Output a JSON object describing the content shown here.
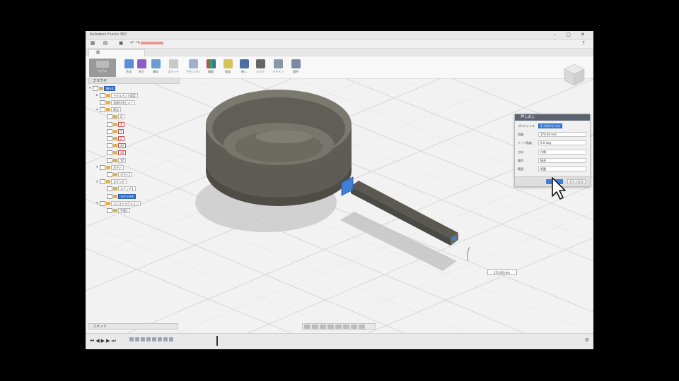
{
  "window": {
    "title": "Autodesk Fusion 360",
    "controls": "– ▢ ✕"
  },
  "document_tab": {
    "label": "鍋"
  },
  "toolbar": {
    "workspace_label": "モデル",
    "tools": [
      {
        "label": "作成",
        "icon": "create-icon"
      },
      {
        "label": "修正",
        "icon": "modify-icon"
      },
      {
        "label": "構成",
        "icon": "construct-icon"
      },
      {
        "label": "スケッチ",
        "icon": "sketch-icon"
      },
      {
        "label": "アセンブリ",
        "icon": "assemble-icon"
      },
      {
        "label": "構築",
        "icon": "build-icon"
      },
      {
        "label": "検査",
        "icon": "inspect-icon"
      },
      {
        "label": "挿入",
        "icon": "insert-icon"
      },
      {
        "label": "メイク",
        "icon": "make-icon"
      },
      {
        "label": "アドイン",
        "icon": "addin-icon"
      },
      {
        "label": "選択",
        "icon": "select-icon"
      }
    ]
  },
  "browser": {
    "header": "ブラウザ",
    "nodes": [
      {
        "label": "鍋 v3",
        "indent": 0,
        "arrow": "▾",
        "selected": true,
        "red": false
      },
      {
        "label": "ドキュメント設定",
        "indent": 1,
        "arrow": "▸",
        "selected": false,
        "red": false
      },
      {
        "label": "名前付きビュー",
        "indent": 1,
        "arrow": "",
        "selected": false,
        "red": false
      },
      {
        "label": "原点",
        "indent": 1,
        "arrow": "▾",
        "selected": false,
        "red": false
      },
      {
        "label": "O",
        "indent": 2,
        "arrow": "",
        "selected": false,
        "red": false
      },
      {
        "label": "X",
        "indent": 2,
        "arrow": "",
        "selected": false,
        "red": true
      },
      {
        "label": "Y",
        "indent": 2,
        "arrow": "",
        "selected": false,
        "red": true
      },
      {
        "label": "Z",
        "indent": 2,
        "arrow": "",
        "selected": false,
        "red": true
      },
      {
        "label": "XY",
        "indent": 2,
        "arrow": "",
        "selected": false,
        "red": true
      },
      {
        "label": "XZ",
        "indent": 2,
        "arrow": "",
        "selected": false,
        "red": true
      },
      {
        "label": "YZ",
        "indent": 2,
        "arrow": "",
        "selected": false,
        "red": false
      },
      {
        "label": "ボディ",
        "indent": 1,
        "arrow": "▾",
        "selected": false,
        "red": false
      },
      {
        "label": "ボディ1",
        "indent": 2,
        "arrow": "",
        "selected": false,
        "red": false
      },
      {
        "label": "スケッチ",
        "indent": 1,
        "arrow": "▾",
        "selected": false,
        "red": false
      },
      {
        "label": "スケッチ1",
        "indent": 2,
        "arrow": "",
        "selected": false,
        "red": false
      },
      {
        "label": "スケッチ2",
        "indent": 2,
        "arrow": "",
        "selected": true,
        "red": false
      },
      {
        "label": "コンストラクション",
        "indent": 1,
        "arrow": "▾",
        "selected": false,
        "red": false
      },
      {
        "label": "平面1",
        "indent": 2,
        "arrow": "",
        "selected": false,
        "red": false
      }
    ]
  },
  "comments": {
    "label": "コメント"
  },
  "dialog": {
    "title": "押し出し",
    "rows": [
      {
        "key": "プロファイル",
        "value": "1 プロファイル"
      },
      {
        "key": "距離",
        "value": "170.00 mm"
      },
      {
        "key": "テーパ角度",
        "value": "0.0 deg"
      },
      {
        "key": "方向",
        "value": "片側"
      },
      {
        "key": "操作",
        "value": "結合"
      },
      {
        "key": "範囲",
        "value": "距離"
      }
    ],
    "ok": "OK",
    "cancel": "キャンセル"
  },
  "distance_input": {
    "value": "170.00 mm"
  },
  "colors": {
    "accent": "#3f7fd6",
    "pan": "#5a5a52",
    "dialog_header": "#5b6470"
  }
}
